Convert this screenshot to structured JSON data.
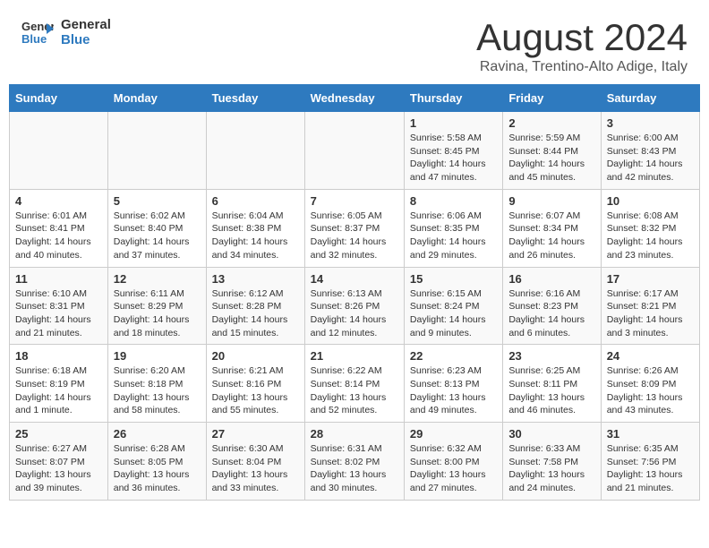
{
  "header": {
    "logo_line1": "General",
    "logo_line2": "Blue",
    "month_year": "August 2024",
    "location": "Ravina, Trentino-Alto Adige, Italy"
  },
  "days_of_week": [
    "Sunday",
    "Monday",
    "Tuesday",
    "Wednesday",
    "Thursday",
    "Friday",
    "Saturday"
  ],
  "weeks": [
    [
      {
        "day": "",
        "info": ""
      },
      {
        "day": "",
        "info": ""
      },
      {
        "day": "",
        "info": ""
      },
      {
        "day": "",
        "info": ""
      },
      {
        "day": "1",
        "info": "Sunrise: 5:58 AM\nSunset: 8:45 PM\nDaylight: 14 hours and 47 minutes."
      },
      {
        "day": "2",
        "info": "Sunrise: 5:59 AM\nSunset: 8:44 PM\nDaylight: 14 hours and 45 minutes."
      },
      {
        "day": "3",
        "info": "Sunrise: 6:00 AM\nSunset: 8:43 PM\nDaylight: 14 hours and 42 minutes."
      }
    ],
    [
      {
        "day": "4",
        "info": "Sunrise: 6:01 AM\nSunset: 8:41 PM\nDaylight: 14 hours and 40 minutes."
      },
      {
        "day": "5",
        "info": "Sunrise: 6:02 AM\nSunset: 8:40 PM\nDaylight: 14 hours and 37 minutes."
      },
      {
        "day": "6",
        "info": "Sunrise: 6:04 AM\nSunset: 8:38 PM\nDaylight: 14 hours and 34 minutes."
      },
      {
        "day": "7",
        "info": "Sunrise: 6:05 AM\nSunset: 8:37 PM\nDaylight: 14 hours and 32 minutes."
      },
      {
        "day": "8",
        "info": "Sunrise: 6:06 AM\nSunset: 8:35 PM\nDaylight: 14 hours and 29 minutes."
      },
      {
        "day": "9",
        "info": "Sunrise: 6:07 AM\nSunset: 8:34 PM\nDaylight: 14 hours and 26 minutes."
      },
      {
        "day": "10",
        "info": "Sunrise: 6:08 AM\nSunset: 8:32 PM\nDaylight: 14 hours and 23 minutes."
      }
    ],
    [
      {
        "day": "11",
        "info": "Sunrise: 6:10 AM\nSunset: 8:31 PM\nDaylight: 14 hours and 21 minutes."
      },
      {
        "day": "12",
        "info": "Sunrise: 6:11 AM\nSunset: 8:29 PM\nDaylight: 14 hours and 18 minutes."
      },
      {
        "day": "13",
        "info": "Sunrise: 6:12 AM\nSunset: 8:28 PM\nDaylight: 14 hours and 15 minutes."
      },
      {
        "day": "14",
        "info": "Sunrise: 6:13 AM\nSunset: 8:26 PM\nDaylight: 14 hours and 12 minutes."
      },
      {
        "day": "15",
        "info": "Sunrise: 6:15 AM\nSunset: 8:24 PM\nDaylight: 14 hours and 9 minutes."
      },
      {
        "day": "16",
        "info": "Sunrise: 6:16 AM\nSunset: 8:23 PM\nDaylight: 14 hours and 6 minutes."
      },
      {
        "day": "17",
        "info": "Sunrise: 6:17 AM\nSunset: 8:21 PM\nDaylight: 14 hours and 3 minutes."
      }
    ],
    [
      {
        "day": "18",
        "info": "Sunrise: 6:18 AM\nSunset: 8:19 PM\nDaylight: 14 hours and 1 minute."
      },
      {
        "day": "19",
        "info": "Sunrise: 6:20 AM\nSunset: 8:18 PM\nDaylight: 13 hours and 58 minutes."
      },
      {
        "day": "20",
        "info": "Sunrise: 6:21 AM\nSunset: 8:16 PM\nDaylight: 13 hours and 55 minutes."
      },
      {
        "day": "21",
        "info": "Sunrise: 6:22 AM\nSunset: 8:14 PM\nDaylight: 13 hours and 52 minutes."
      },
      {
        "day": "22",
        "info": "Sunrise: 6:23 AM\nSunset: 8:13 PM\nDaylight: 13 hours and 49 minutes."
      },
      {
        "day": "23",
        "info": "Sunrise: 6:25 AM\nSunset: 8:11 PM\nDaylight: 13 hours and 46 minutes."
      },
      {
        "day": "24",
        "info": "Sunrise: 6:26 AM\nSunset: 8:09 PM\nDaylight: 13 hours and 43 minutes."
      }
    ],
    [
      {
        "day": "25",
        "info": "Sunrise: 6:27 AM\nSunset: 8:07 PM\nDaylight: 13 hours and 39 minutes."
      },
      {
        "day": "26",
        "info": "Sunrise: 6:28 AM\nSunset: 8:05 PM\nDaylight: 13 hours and 36 minutes."
      },
      {
        "day": "27",
        "info": "Sunrise: 6:30 AM\nSunset: 8:04 PM\nDaylight: 13 hours and 33 minutes."
      },
      {
        "day": "28",
        "info": "Sunrise: 6:31 AM\nSunset: 8:02 PM\nDaylight: 13 hours and 30 minutes."
      },
      {
        "day": "29",
        "info": "Sunrise: 6:32 AM\nSunset: 8:00 PM\nDaylight: 13 hours and 27 minutes."
      },
      {
        "day": "30",
        "info": "Sunrise: 6:33 AM\nSunset: 7:58 PM\nDaylight: 13 hours and 24 minutes."
      },
      {
        "day": "31",
        "info": "Sunrise: 6:35 AM\nSunset: 7:56 PM\nDaylight: 13 hours and 21 minutes."
      }
    ]
  ]
}
